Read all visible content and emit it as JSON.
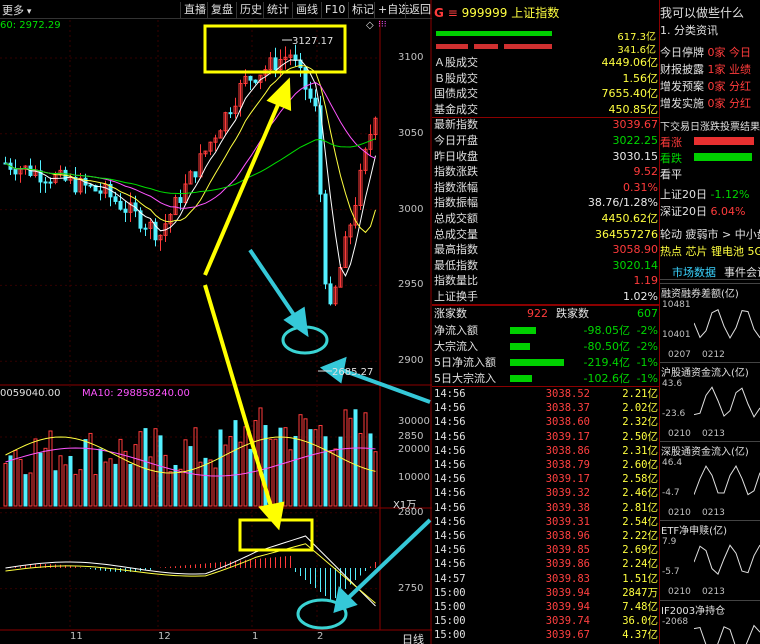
{
  "toolbar": {
    "more": "更多",
    "buttons": [
      "直播",
      "复盘",
      "历史",
      "统计",
      "画线",
      "F10",
      "标记",
      "+自选",
      "返回"
    ]
  },
  "chart": {
    "ma_label": "60: 2972.29",
    "price_ticks": [
      "3100",
      "3050",
      "3000",
      "2950",
      "2900",
      "2850",
      "2800",
      "2750",
      "2700"
    ],
    "high_label": "3127.17",
    "low_label": "2685.27",
    "vol_label_a": "0059040.00",
    "vol_label_b": "MA10: 298858240.00",
    "vol_ticks": [
      "30000",
      "20000",
      "10000"
    ],
    "vol_unit": "X1万",
    "date_ticks": [
      "11",
      "12",
      "1",
      "2"
    ],
    "footer_right": "日线"
  },
  "quote": {
    "code_prefix": "G",
    "code": "999999",
    "name": "上证指数",
    "bar_vals": [
      "617.3亿",
      "341.6亿"
    ],
    "rows": [
      {
        "k": "Ａ股成交",
        "v": "4449.06亿",
        "c": "yel"
      },
      {
        "k": "Ｂ股成交",
        "v": "1.56亿",
        "c": "yel"
      },
      {
        "k": "国债成交",
        "v": "7655.40亿",
        "c": "yel"
      },
      {
        "k": "基金成交",
        "v": "450.85亿",
        "c": "yel"
      },
      {
        "k": "最新指数",
        "v": "3039.67",
        "c": "red"
      },
      {
        "k": "今日开盘",
        "v": "3022.25",
        "c": "grn"
      },
      {
        "k": "昨日收盘",
        "v": "3030.15",
        "c": "wht"
      },
      {
        "k": "指数涨跌",
        "v": "9.52",
        "c": "red"
      },
      {
        "k": "指数涨幅",
        "v": "0.31%",
        "c": "red"
      },
      {
        "k": "指数振幅",
        "v": "38.76/1.28%",
        "c": "wht"
      },
      {
        "k": "总成交额",
        "v": "4450.62亿",
        "c": "yel"
      },
      {
        "k": "总成交量",
        "v": "364557276",
        "c": "yel"
      },
      {
        "k": "最高指数",
        "v": "3058.90",
        "c": "red"
      },
      {
        "k": "最低指数",
        "v": "3020.14",
        "c": "grn"
      },
      {
        "k": "指数量比",
        "v": "1.19",
        "c": "red"
      },
      {
        "k": "上证换手",
        "v": "1.02%",
        "c": "wht"
      }
    ],
    "up_label": "涨家数",
    "up_val": "922",
    "down_label": "跌家数",
    "down_val": "607",
    "flows": [
      {
        "k": "净流入额",
        "v": "-98.05亿",
        "p": "-2%"
      },
      {
        "k": "大宗流入",
        "v": "-80.50亿",
        "p": "-2%"
      },
      {
        "k": "5日净流入额",
        "v": "-219.4亿",
        "p": "-1%"
      },
      {
        "k": "5日大宗流入",
        "v": "-102.6亿",
        "p": "-1%"
      }
    ],
    "ticks": [
      {
        "t": "14:56",
        "p": "3038.52",
        "a": "2.21亿",
        "c": "yel"
      },
      {
        "t": "14:56",
        "p": "3038.37",
        "a": "2.02亿",
        "c": "yel"
      },
      {
        "t": "14:56",
        "p": "3038.60",
        "a": "2.32亿",
        "c": "yel"
      },
      {
        "t": "14:56",
        "p": "3039.17",
        "a": "2.50亿",
        "c": "yel"
      },
      {
        "t": "14:56",
        "p": "3038.86",
        "a": "2.31亿",
        "c": "yel"
      },
      {
        "t": "14:56",
        "p": "3038.79",
        "a": "2.60亿",
        "c": "yel"
      },
      {
        "t": "14:56",
        "p": "3039.17",
        "a": "2.58亿",
        "c": "yel"
      },
      {
        "t": "14:56",
        "p": "3039.32",
        "a": "2.46亿",
        "c": "yel"
      },
      {
        "t": "14:56",
        "p": "3039.38",
        "a": "2.81亿",
        "c": "yel"
      },
      {
        "t": "14:56",
        "p": "3039.31",
        "a": "2.54亿",
        "c": "yel"
      },
      {
        "t": "14:56",
        "p": "3038.96",
        "a": "2.22亿",
        "c": "yel"
      },
      {
        "t": "14:56",
        "p": "3039.85",
        "a": "2.69亿",
        "c": "yel"
      },
      {
        "t": "14:56",
        "p": "3039.86",
        "a": "2.24亿",
        "c": "yel"
      },
      {
        "t": "14:57",
        "p": "3039.83",
        "a": "1.51亿",
        "c": "yel"
      },
      {
        "t": "15:00",
        "p": "3039.94",
        "a": "2847万",
        "c": "yel"
      },
      {
        "t": "15:00",
        "p": "3039.94",
        "a": "7.48亿",
        "c": "yel"
      },
      {
        "t": "15:00",
        "p": "3039.74",
        "a": "36.0亿",
        "c": "yel"
      },
      {
        "t": "15:00",
        "p": "3039.67",
        "a": "4.37亿",
        "c": "yel"
      }
    ]
  },
  "side": {
    "q_title": "我可以做些什么",
    "q_item": "1. 分类资讯",
    "stats": [
      {
        "k": "今日停牌",
        "v": "0家 今日"
      },
      {
        "k": "财报披露",
        "v": "1家 业绩"
      },
      {
        "k": "增发预案",
        "v": "0家 分红"
      },
      {
        "k": "增发实施",
        "v": "0家 分红"
      }
    ],
    "vote_title": "下交易日涨跌投票结果",
    "vote": [
      {
        "k": "看涨"
      },
      {
        "k": "看跌"
      },
      {
        "k": "看平"
      }
    ],
    "idx": [
      {
        "k": "上证20日",
        "v": "-1.12%",
        "c": "grn"
      },
      {
        "k": "深证20日",
        "v": "6.04%",
        "c": "red"
      }
    ],
    "rotate": "轮动 疲弱市 > 中小盘",
    "hot": "热点 芯片 锂电池 5G",
    "tabs": [
      "市场数据",
      "事件会议"
    ],
    "panels": [
      {
        "title": "融资融券差额(亿)",
        "y": [
          "10481",
          "10401"
        ],
        "x": [
          "0207",
          "0212"
        ]
      },
      {
        "title": "沪股通资金流入(亿)",
        "y": [
          "43.6",
          "-23.6"
        ],
        "x": [
          "0210",
          "0213"
        ]
      },
      {
        "title": "深股通资金流入(亿)",
        "y": [
          "46.4",
          "-4.7"
        ],
        "x": [
          "0210",
          "0213"
        ]
      },
      {
        "title": "ETF净申赎(亿)",
        "y": [
          "7.9",
          "-5.7"
        ],
        "x": [
          "0210",
          "0213"
        ]
      },
      {
        "title": "IF2003净持仓",
        "y": [
          "-2068"
        ],
        "x": []
      }
    ]
  }
}
